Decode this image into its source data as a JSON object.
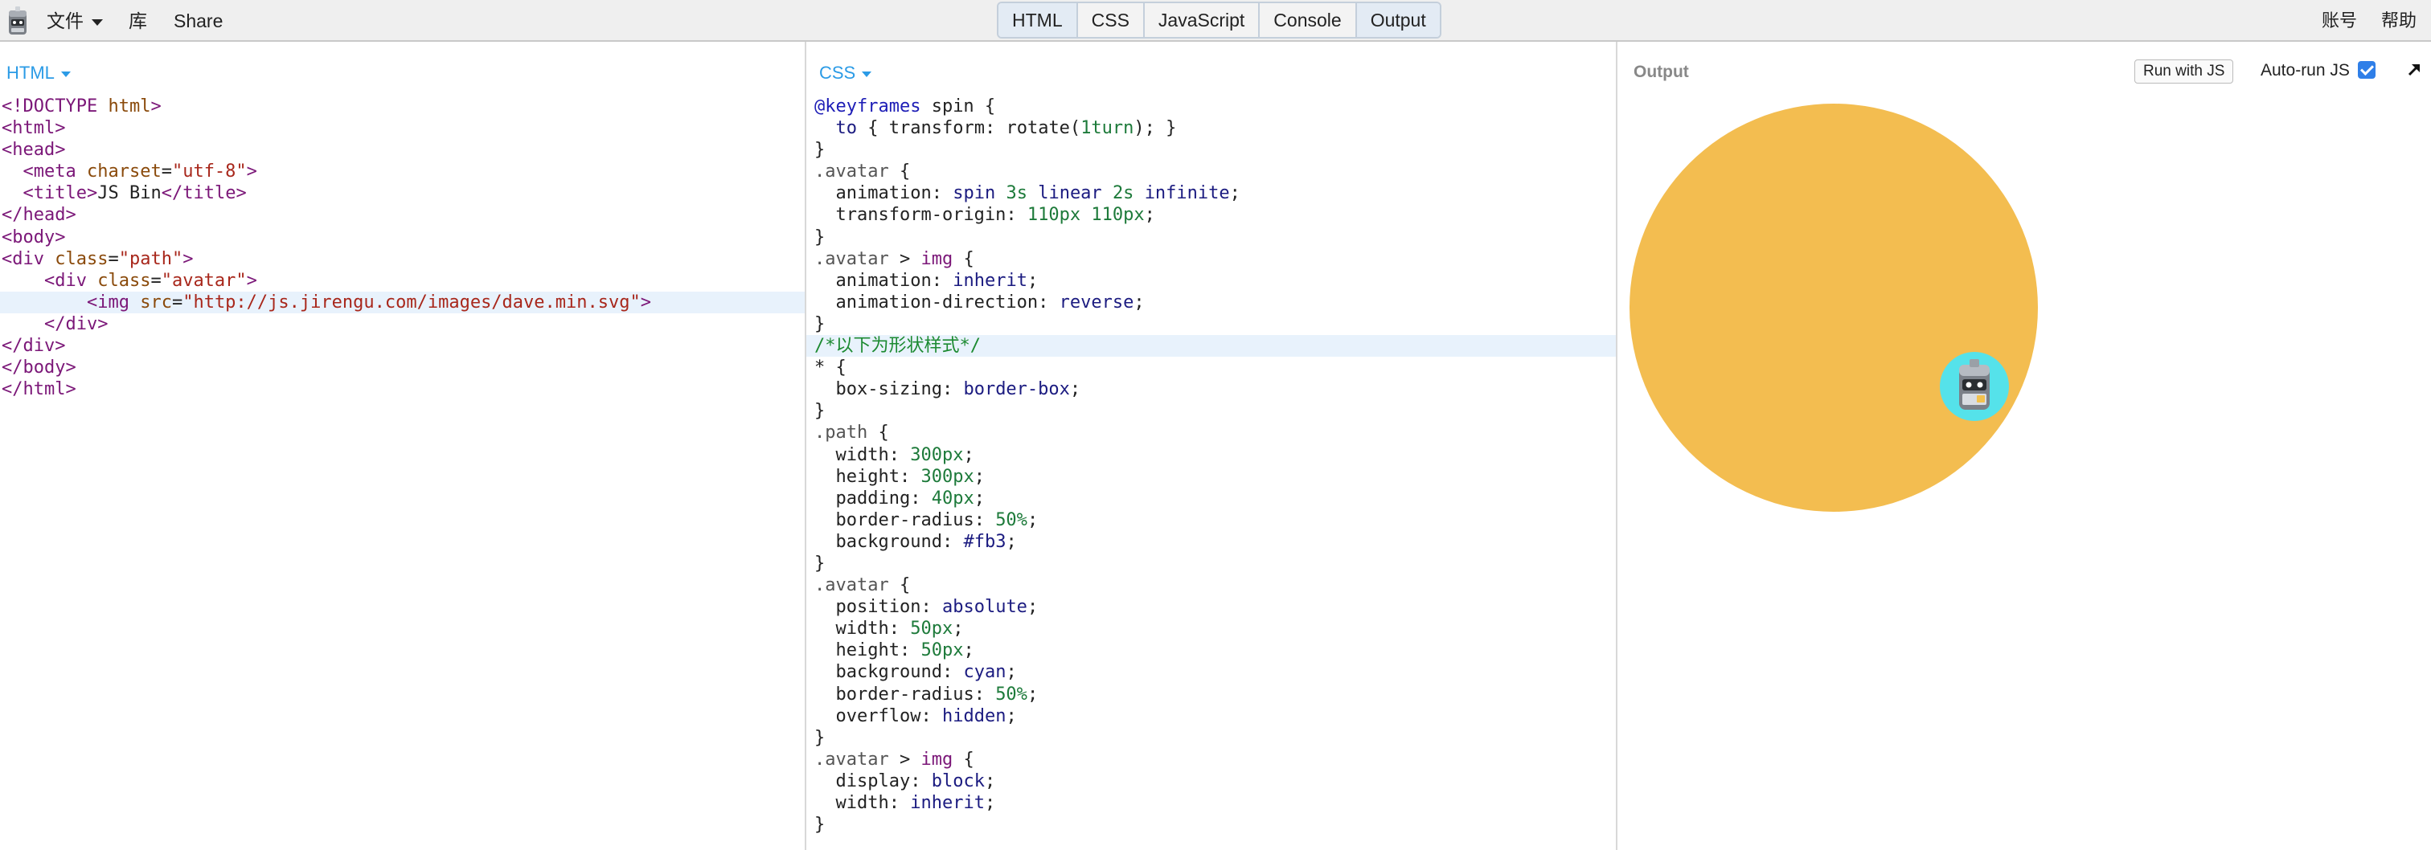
{
  "topbar": {
    "file_menu": "文件",
    "library": "库",
    "share": "Share",
    "tabs": [
      {
        "label": "HTML",
        "active": true
      },
      {
        "label": "CSS",
        "active": false
      },
      {
        "label": "JavaScript",
        "active": false
      },
      {
        "label": "Console",
        "active": false
      },
      {
        "label": "Output",
        "active": true
      }
    ],
    "account": "账号",
    "help": "帮助"
  },
  "html_panel": {
    "label": "HTML",
    "lines": [
      "<!DOCTYPE html>",
      "<html>",
      "<head>",
      "  <meta charset=\"utf-8\">",
      "  <title>JS Bin</title>",
      "</head>",
      "<body>",
      "<div class=\"path\">",
      "    <div class=\"avatar\">",
      "        <img src=\"http://js.jirengu.com/images/dave.min.svg\">",
      "    </div>",
      "</div>",
      "</body>",
      "</html>"
    ]
  },
  "css_panel": {
    "label": "CSS",
    "lines": [
      "@keyframes spin {",
      "  to { transform: rotate(1turn); }",
      "}",
      ".avatar {",
      "  animation: spin 3s linear 2s infinite;",
      "  transform-origin: 110px 110px;",
      "}",
      ".avatar > img {",
      "  animation: inherit;",
      "  animation-direction: reverse;",
      "}",
      "/*以下为形状样式*/",
      "* {",
      "  box-sizing: border-box;",
      "}",
      ".path {",
      "  width: 300px;",
      "  height: 300px;",
      "  padding: 40px;",
      "  border-radius: 50%;",
      "  background: #fb3;",
      "}",
      ".avatar {",
      "  position: absolute;",
      "  width: 50px;",
      "  height: 50px;",
      "  background: cyan;",
      "  border-radius: 50%;",
      "  overflow: hidden;",
      "}",
      ".avatar > img {",
      "  display: block;",
      "  width: inherit;",
      "}"
    ]
  },
  "output_panel": {
    "label": "Output",
    "run_button": "Run with JS",
    "autorun_label": "Auto-run JS",
    "autorun_checked": true
  },
  "colors": {
    "path_background": "#f3bd50",
    "avatar_background": "#55e2ea",
    "accent": "#2b9be6"
  }
}
